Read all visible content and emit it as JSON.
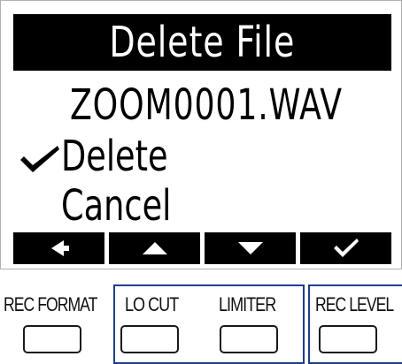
{
  "screen": {
    "title": "Delete File",
    "filename": "ZOOM0001.WAV",
    "options": [
      {
        "label": "Delete",
        "selected": true
      },
      {
        "label": "Cancel",
        "selected": false
      }
    ],
    "function_keys": [
      {
        "icon": "arrow-left-icon"
      },
      {
        "icon": "arrow-up-icon"
      },
      {
        "icon": "arrow-down-icon"
      },
      {
        "icon": "checkmark-icon"
      }
    ]
  },
  "buttons": [
    {
      "label": "REC FORMAT"
    },
    {
      "label": "LO CUT"
    },
    {
      "label": "LIMITER"
    },
    {
      "label": "REC LEVEL"
    }
  ],
  "colors": {
    "lcd_background": "#ffffff",
    "lcd_ink": "#000000",
    "group_frame": "#1e3e8a"
  }
}
